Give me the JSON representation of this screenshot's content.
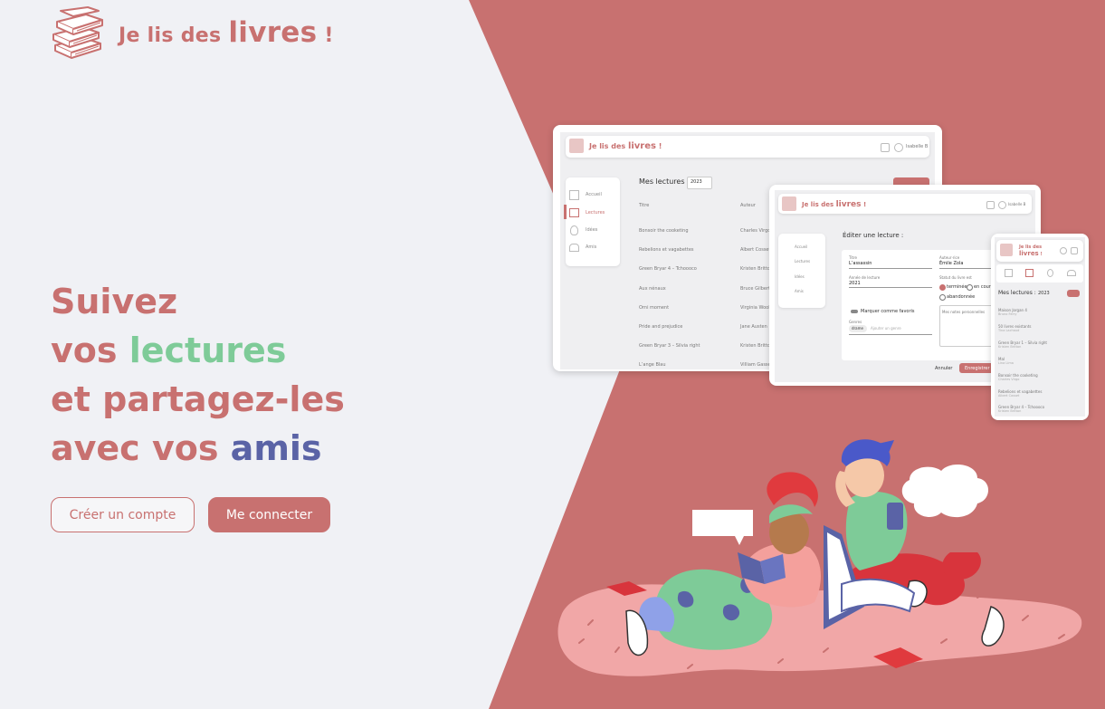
{
  "colors": {
    "accent": "#c87170",
    "green": "#7ecb98",
    "blue": "#5a63a6",
    "background": "#f0f1f5"
  },
  "logo": {
    "prefix": "Je lis des",
    "big": "livres",
    "suffix": "!",
    "icon": "books-stack-icon"
  },
  "headline": {
    "line1": "Suivez",
    "line2_a": "vos ",
    "line2_b": "lectures",
    "line3": "et partagez-les",
    "line4_a": "avec vos ",
    "line4_b": "amis"
  },
  "buttons": {
    "signup": "Créer un compte",
    "login": "Me connecter"
  },
  "mockup_desktop": {
    "logo_prefix": "Je lis des",
    "logo_big": "livres",
    "logo_suffix": "!",
    "user": "Isabelle B",
    "heading": "Mes lectures :",
    "year": "2023",
    "col_title": "Titre",
    "col_author": "Auteur",
    "nav": [
      "Accueil",
      "Lectures",
      "Idées",
      "Amis"
    ],
    "rows": [
      {
        "title": "Bonsoir the cooketing",
        "author": "Charles Virgo"
      },
      {
        "title": "Rebelions et vagabettes",
        "author": "Albert Cosset"
      },
      {
        "title": "Green Bryar 4 – Tchoooco",
        "author": "Kristen Britton"
      },
      {
        "title": "Aux nénaux",
        "author": "Bruce Gilbert"
      },
      {
        "title": "Orni moment",
        "author": "Virginia Woolf"
      },
      {
        "title": "Pride and prejudice",
        "author": "Jane Austen"
      },
      {
        "title": "Green Bryar 3 – Silvia right",
        "author": "Kristen Britton"
      },
      {
        "title": "L’ange Blau",
        "author": "Villiam Gasset"
      }
    ]
  },
  "mockup_edit": {
    "logo_prefix": "Je lis des",
    "logo_big": "livres",
    "logo_suffix": "!",
    "user": "Isabelle B",
    "heading": "Éditer une lecture :",
    "title_label": "Titre",
    "title_value": "L’assassin",
    "author_label": "Auteur·rice",
    "author_value": "Émile Zola",
    "year_label": "Année de lecture",
    "year_value": "2021",
    "status_label": "Statut du livre est",
    "status_options": [
      "terminée",
      "en cours",
      "abandonnée"
    ],
    "favorite": "Marquer comme favoris",
    "genres_label": "Genres",
    "genre_tag": "drame",
    "genre_placeholder": "Ajouter un genre",
    "notes": "Mes notes personnelles",
    "cancel": "Annuler",
    "save": "Enregistrer",
    "nav": [
      "Accueil",
      "Lectures",
      "Idées",
      "Amis"
    ]
  },
  "mockup_mobile": {
    "logo_prefix": "Je lis des",
    "logo_big": "livres",
    "logo_suffix": "!",
    "heading": "Mes lectures :",
    "year": "2023",
    "rows": [
      {
        "title": "Maison Jorgan 4",
        "author": "Bruno Ferry"
      },
      {
        "title": "50 livres existants",
        "author": "Tina Lachaud"
      },
      {
        "title": "Green Bryar 1 – Silvia right",
        "author": "Kristen Britton"
      },
      {
        "title": "Mal",
        "author": "Lina Lima"
      },
      {
        "title": "Bonsoir the cooketing",
        "author": "Charles Virgo"
      },
      {
        "title": "Rebelions et vagabettes",
        "author": "Albert Cosset"
      },
      {
        "title": "Green Bryar 4 – Tchoooco",
        "author": "Kristen Britton"
      }
    ]
  },
  "illustration": {
    "icon": "reading-friends-illustration"
  }
}
